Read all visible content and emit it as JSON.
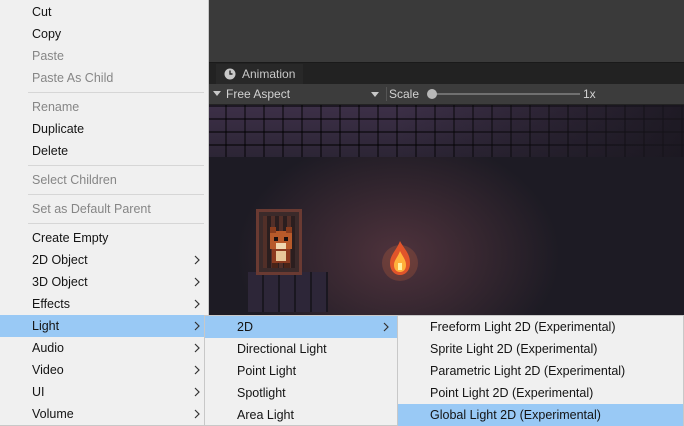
{
  "tab": {
    "label": "Animation"
  },
  "view_toolbar": {
    "aspect": "Free Aspect",
    "scale_label": "Scale",
    "scale_value": "1x",
    "scale_fraction": 0.0
  },
  "menu_main": {
    "items": [
      {
        "label": "Cut"
      },
      {
        "label": "Copy"
      },
      {
        "label": "Paste"
      },
      {
        "label": "Paste As Child"
      },
      {
        "label": "Rename"
      },
      {
        "label": "Duplicate"
      },
      {
        "label": "Delete"
      },
      {
        "label": "Select Children"
      },
      {
        "label": "Set as Default Parent"
      },
      {
        "label": "Create Empty"
      },
      {
        "label": "2D Object"
      },
      {
        "label": "3D Object"
      },
      {
        "label": "Effects"
      },
      {
        "label": "Light"
      },
      {
        "label": "Audio"
      },
      {
        "label": "Video"
      },
      {
        "label": "UI"
      },
      {
        "label": "Volume"
      }
    ]
  },
  "menu_light": {
    "items": [
      {
        "label": "2D"
      },
      {
        "label": "Directional Light"
      },
      {
        "label": "Point Light"
      },
      {
        "label": "Spotlight"
      },
      {
        "label": "Area Light"
      }
    ]
  },
  "menu_2d": {
    "items": [
      {
        "label": "Freeform Light 2D (Experimental)"
      },
      {
        "label": "Sprite Light 2D (Experimental)"
      },
      {
        "label": "Parametric Light 2D (Experimental)"
      },
      {
        "label": "Point Light 2D (Experimental)"
      },
      {
        "label": "Global Light 2D (Experimental)"
      }
    ]
  },
  "colors": {
    "menu_bg": "#f0f0f0",
    "highlight": "#99c9f5",
    "disabled_text": "#868686",
    "editor_dark": "#3c3c3c"
  }
}
